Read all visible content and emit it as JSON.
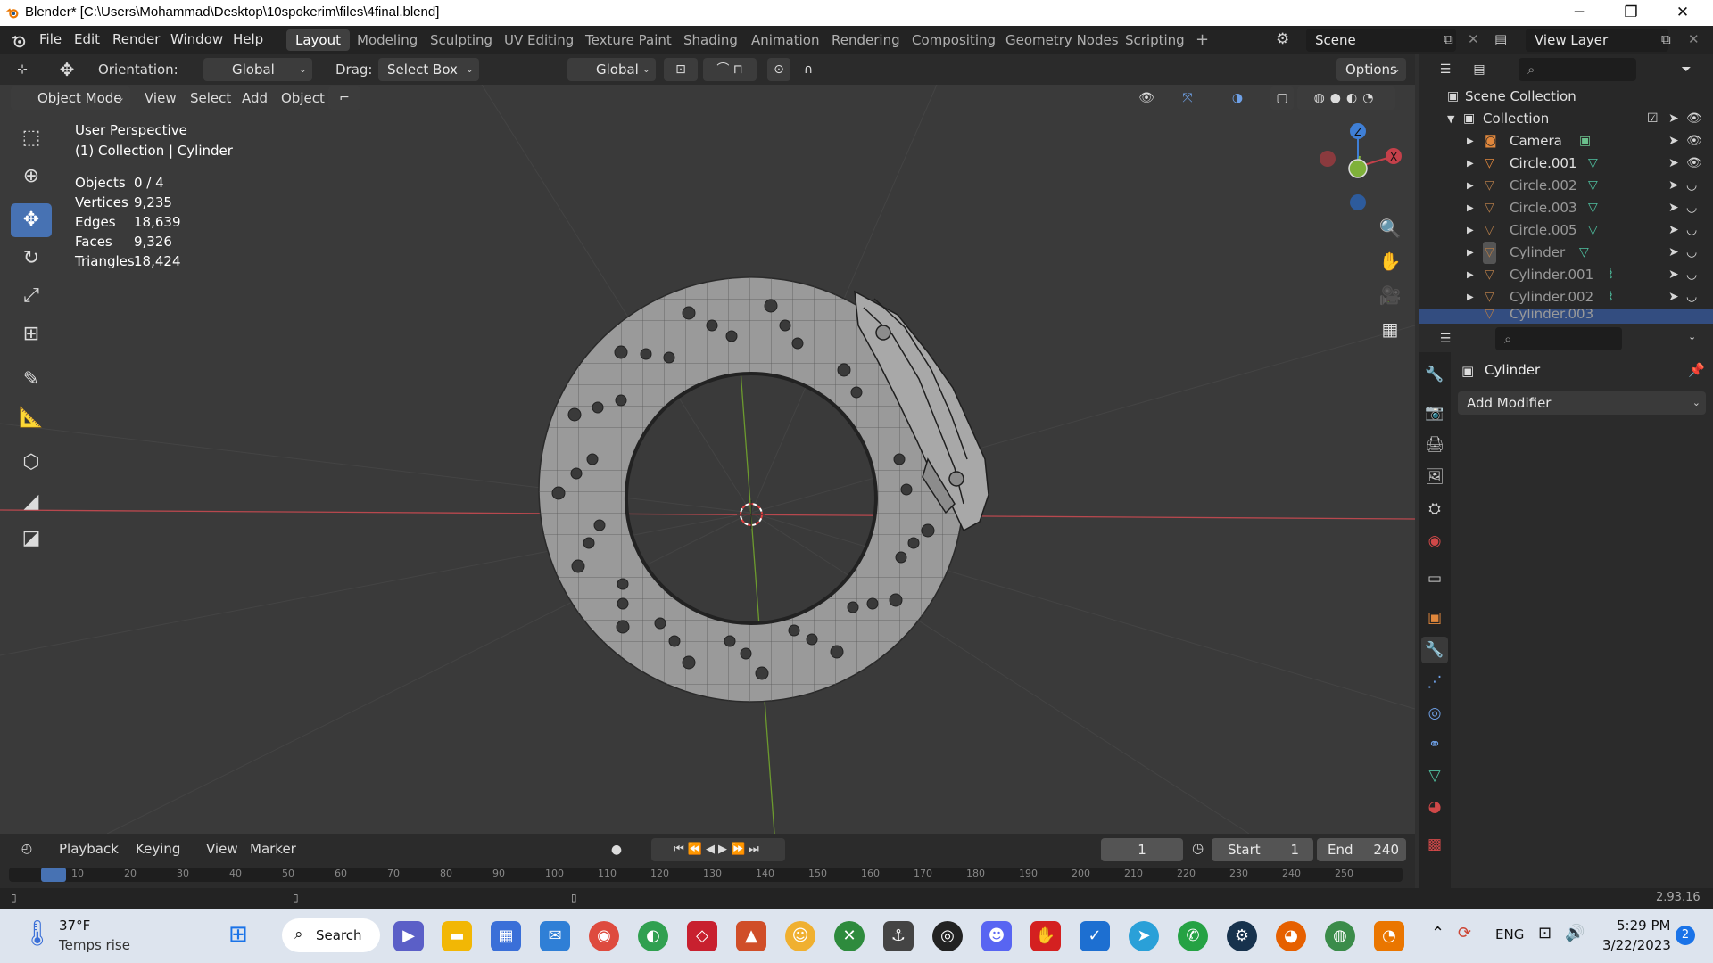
{
  "window": {
    "title": "Blender* [C:\\Users\\Mohammad\\Desktop\\10spokerim\\files\\4final.blend]",
    "minimize": "─",
    "maximize": "❐",
    "close": "✕"
  },
  "menu": {
    "items": [
      "File",
      "Edit",
      "Render",
      "Window",
      "Help"
    ]
  },
  "workspaces": {
    "tabs": [
      "Layout",
      "Modeling",
      "Sculpting",
      "UV Editing",
      "Texture Paint",
      "Shading",
      "Animation",
      "Rendering",
      "Compositing",
      "Geometry Nodes",
      "Scripting"
    ],
    "active": "Layout",
    "add": "+"
  },
  "scene": {
    "name": "Scene",
    "view_layer": "View Layer"
  },
  "tool_header": {
    "orientation_label": "Orientation:",
    "orientation_value": "Global",
    "drag_label": "Drag:",
    "drag_value": "Select Box",
    "transform_orientation": "Global",
    "options": "Options"
  },
  "viewport_header": {
    "mode": "Object Mode",
    "menus": [
      "View",
      "Select",
      "Add",
      "Object"
    ]
  },
  "overlay_text": {
    "perspective": "User Perspective",
    "collection": "(1) Collection | Cylinder",
    "stats": [
      {
        "label": "Objects",
        "value": "0 / 4"
      },
      {
        "label": "Vertices",
        "value": "9,235"
      },
      {
        "label": "Edges",
        "value": "18,639"
      },
      {
        "label": "Faces",
        "value": "9,326"
      },
      {
        "label": "Triangles",
        "value": "18,424"
      }
    ]
  },
  "gizmo": {
    "z": "Z",
    "x": "X"
  },
  "outliner": {
    "scene_collection": "Scene Collection",
    "collection": "Collection",
    "objects": [
      "Camera",
      "Circle.001",
      "Circle.002",
      "Circle.003",
      "Circle.005",
      "Cylinder",
      "Cylinder.001",
      "Cylinder.002",
      "Cylinder.003"
    ]
  },
  "properties": {
    "object_name": "Cylinder",
    "add_modifier": "Add Modifier"
  },
  "timeline": {
    "menus": [
      "Playback",
      "Keying",
      "View",
      "Marker"
    ],
    "current_frame": "1",
    "start_label": "Start",
    "start": "1",
    "end_label": "End",
    "end": "240",
    "ruler": [
      "10",
      "20",
      "30",
      "40",
      "50",
      "60",
      "70",
      "80",
      "90",
      "100",
      "110",
      "120",
      "130",
      "140",
      "150",
      "160",
      "170",
      "180",
      "190",
      "200",
      "210",
      "220",
      "230",
      "240",
      "250"
    ]
  },
  "status": {
    "version": "2.93.16"
  },
  "taskbar": {
    "weather_temp": "37°F",
    "weather_desc": "Temps rise",
    "search": "Search",
    "lang": "ENG",
    "time": "5:29 PM",
    "date": "3/22/2023",
    "notif": "2"
  },
  "colors": {
    "accent": "#4772b3",
    "axis_x": "#c4404a",
    "axis_y": "#7fb13a",
    "axis_z": "#3f7fd6",
    "mesh_fill": "#9a9a9a"
  }
}
